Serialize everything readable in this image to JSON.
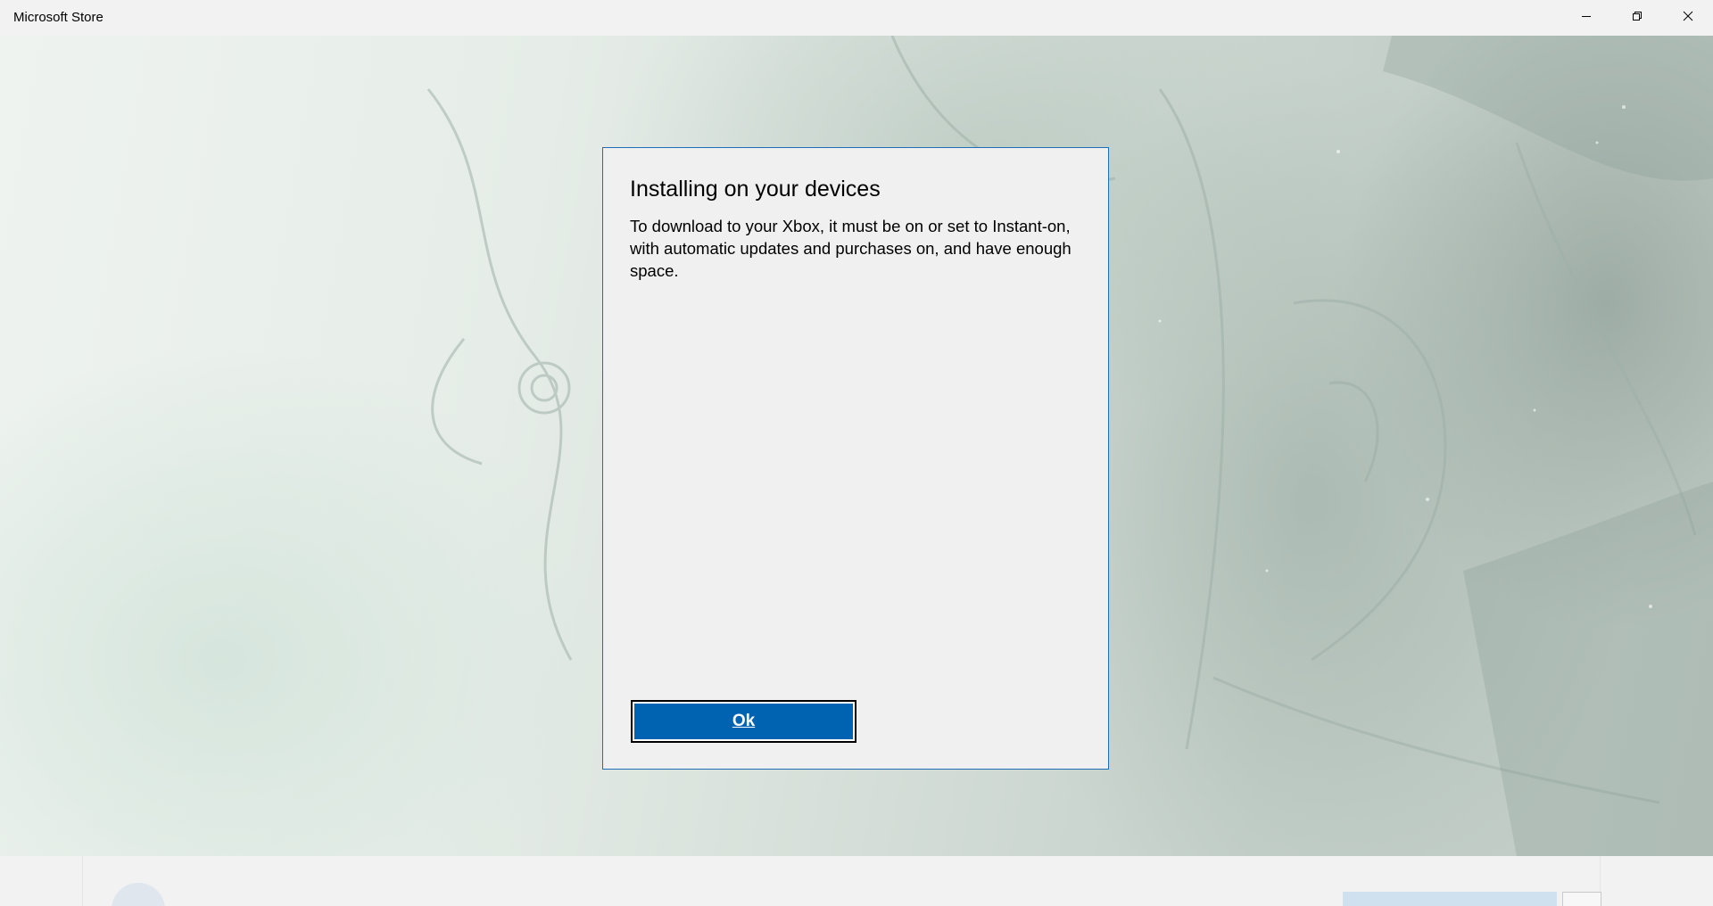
{
  "window": {
    "title": "Microsoft Store",
    "controls": {
      "minimize_icon": "minimize-icon",
      "restore_icon": "restore-icon",
      "close_icon": "close-icon"
    }
  },
  "dialog": {
    "title": "Installing on your devices",
    "body": "To download to your Xbox, it must be on or set to Instant-on, with automatic updates and purchases on, and have enough space.",
    "ok_label": "Ok"
  },
  "colors": {
    "accent": "#0063b1",
    "dialog_border": "#1d6fb5",
    "dialog_background": "#f0f0f0",
    "titlebar_background": "#f2f2f2"
  }
}
